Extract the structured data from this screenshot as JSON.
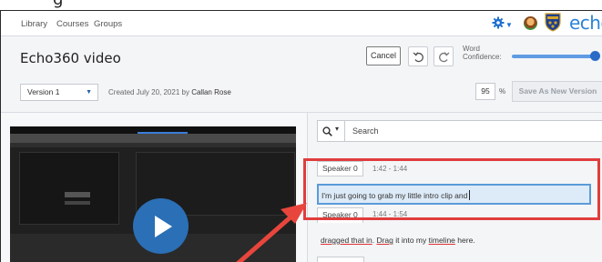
{
  "caption": "g",
  "nav": {
    "links": [
      "Library",
      "Courses",
      "Groups"
    ],
    "brand": "echo"
  },
  "header": {
    "title": "Echo360 video",
    "cancel_label": "Cancel",
    "word_confidence_label_1": "Word",
    "word_confidence_label_2": "Confidence:",
    "word_confidence_level": 0.95
  },
  "subheader": {
    "version_value": "Version 1",
    "created_prefix": "Created July 20, 2021 by",
    "created_by": "Callan Rose",
    "confidence_value": "95",
    "percent_sign": "%",
    "save_label": "Save As New Version"
  },
  "transcript": {
    "search_placeholder": "Search",
    "entries": [
      {
        "speaker": "Speaker 0",
        "time": "1:42 - 1:44",
        "text": "I'm just going to grab my little intro clip and"
      },
      {
        "speaker": "Speaker 0",
        "time": "1:44 - 1:54"
      }
    ],
    "line2_parts": [
      {
        "text": "dragged that in",
        "underline": true
      },
      {
        "text": ". ",
        "underline": false
      },
      {
        "text": "Drag",
        "underline": true
      },
      {
        "text": " it into my ",
        "underline": false
      },
      {
        "text": "timeline",
        "underline": true
      },
      {
        "text": " here.",
        "underline": false
      }
    ]
  },
  "colors": {
    "accent": "#2c83d9",
    "highlight_border": "#e03d3d",
    "selected_line": "#ddeaf7",
    "play_button": "#2b6fb6"
  }
}
